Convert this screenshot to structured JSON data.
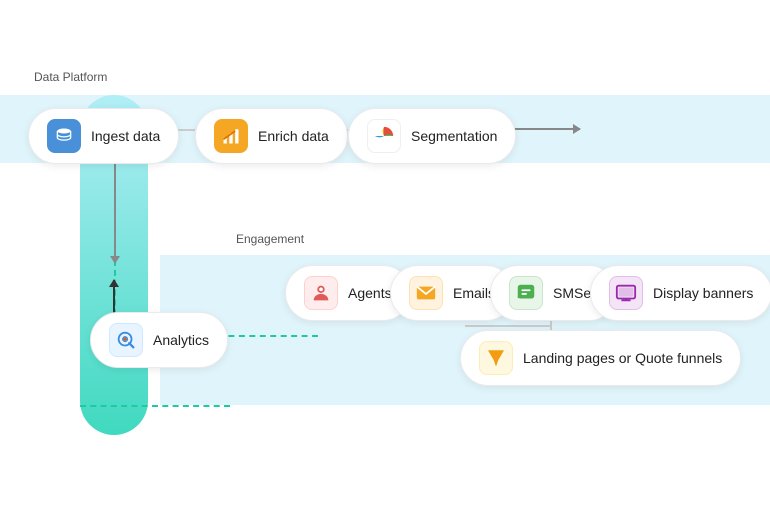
{
  "diagram": {
    "pills": {
      "ingest": {
        "label": "Ingest data"
      },
      "enrich": {
        "label": "Enrich data"
      },
      "segmentation": {
        "label": "Segmentation"
      },
      "analytics": {
        "label": "Analytics"
      },
      "agents": {
        "label": "Agents"
      },
      "emails": {
        "label": "Emails"
      },
      "smses": {
        "label": "SMSes"
      },
      "display": {
        "label": "Display banners"
      },
      "landing": {
        "label": "Landing pages\nor Quote funnels"
      }
    },
    "topLabel1": "Data Platform",
    "topLabel2": "Engagement"
  }
}
